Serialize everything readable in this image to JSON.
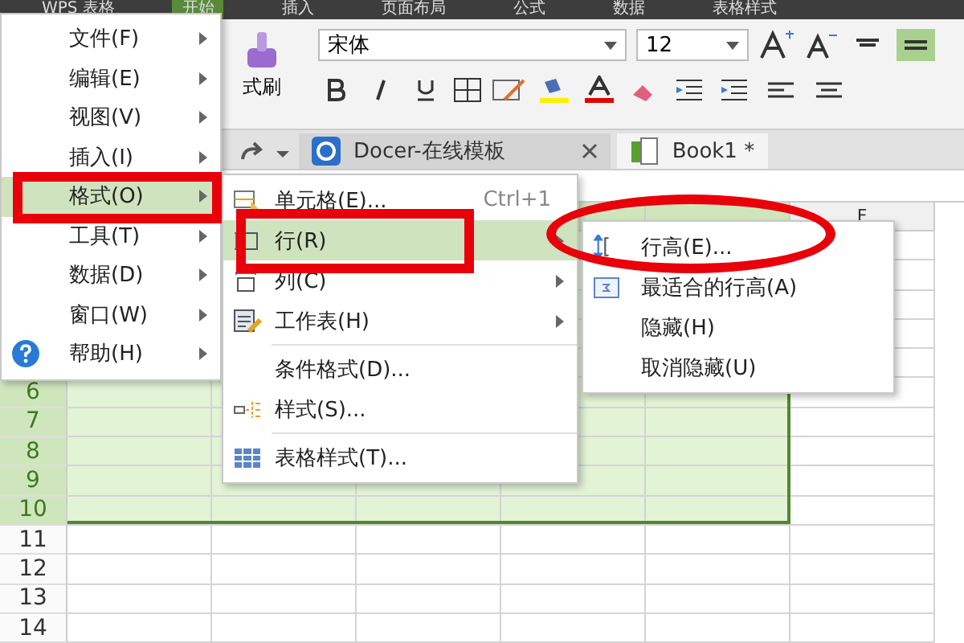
{
  "ribbon_tabs": [
    {
      "label": "WPS 表格",
      "selected": false
    },
    {
      "label": "开始",
      "selected": true
    },
    {
      "label": "插入",
      "selected": false
    },
    {
      "label": "页面布局",
      "selected": false
    },
    {
      "label": "公式",
      "selected": false
    },
    {
      "label": "数据",
      "selected": false
    },
    {
      "label": "表格样式",
      "selected": false
    }
  ],
  "toolbar": {
    "format_painter": "式刷",
    "font": "宋体",
    "size": "12"
  },
  "doc_tabs": [
    {
      "label": "Docer-在线模板",
      "kind": "docer",
      "selected": false
    },
    {
      "label": "Book1 *",
      "kind": "book",
      "selected": true
    }
  ],
  "columns": [
    {
      "label": "F",
      "selected": false
    }
  ],
  "rows": [
    {
      "label": "6",
      "selected": true
    },
    {
      "label": "7",
      "selected": true
    },
    {
      "label": "8",
      "selected": true
    },
    {
      "label": "9",
      "selected": true
    },
    {
      "label": "10",
      "selected": true
    },
    {
      "label": "11",
      "selected": false
    },
    {
      "label": "12",
      "selected": false
    },
    {
      "label": "13",
      "selected": false
    },
    {
      "label": "14",
      "selected": false
    }
  ],
  "main_menu": [
    {
      "label": "文件(F)",
      "selected": false
    },
    {
      "label": "编辑(E)",
      "selected": false
    },
    {
      "label": "视图(V)",
      "selected": false
    },
    {
      "label": "插入(I)",
      "selected": false
    },
    {
      "label": "格式(O)",
      "selected": true
    },
    {
      "label": "工具(T)",
      "selected": false
    },
    {
      "label": "数据(D)",
      "selected": false
    },
    {
      "label": "窗口(W)",
      "selected": false
    },
    {
      "label": "帮助(H)",
      "selected": false,
      "kind": "help"
    }
  ],
  "format_menu": [
    {
      "label": "单元格(E)...",
      "shortcut": "Ctrl+1",
      "kind": "cell",
      "submenu": false,
      "selected": false
    },
    {
      "label": "行(R)",
      "kind": "row",
      "submenu": true,
      "selected": true
    },
    {
      "label": "列(C)",
      "kind": "column",
      "submenu": true,
      "selected": false
    },
    {
      "label": "工作表(H)",
      "kind": "sheet",
      "submenu": true,
      "selected": false,
      "separator_after": true
    },
    {
      "label": "条件格式(D)...",
      "kind": "none",
      "submenu": false,
      "selected": false
    },
    {
      "label": "样式(S)...",
      "kind": "style",
      "submenu": false,
      "selected": false,
      "separator_after": true
    },
    {
      "label": "表格样式(T)...",
      "kind": "table",
      "submenu": false,
      "selected": false
    }
  ],
  "row_menu": [
    {
      "label": "行高(E)...",
      "kind": "height"
    },
    {
      "label": "最适合的行高(A)",
      "kind": "fit"
    },
    {
      "label": "隐藏(H)",
      "kind": "none"
    },
    {
      "label": "取消隐藏(U)",
      "kind": "none"
    }
  ]
}
